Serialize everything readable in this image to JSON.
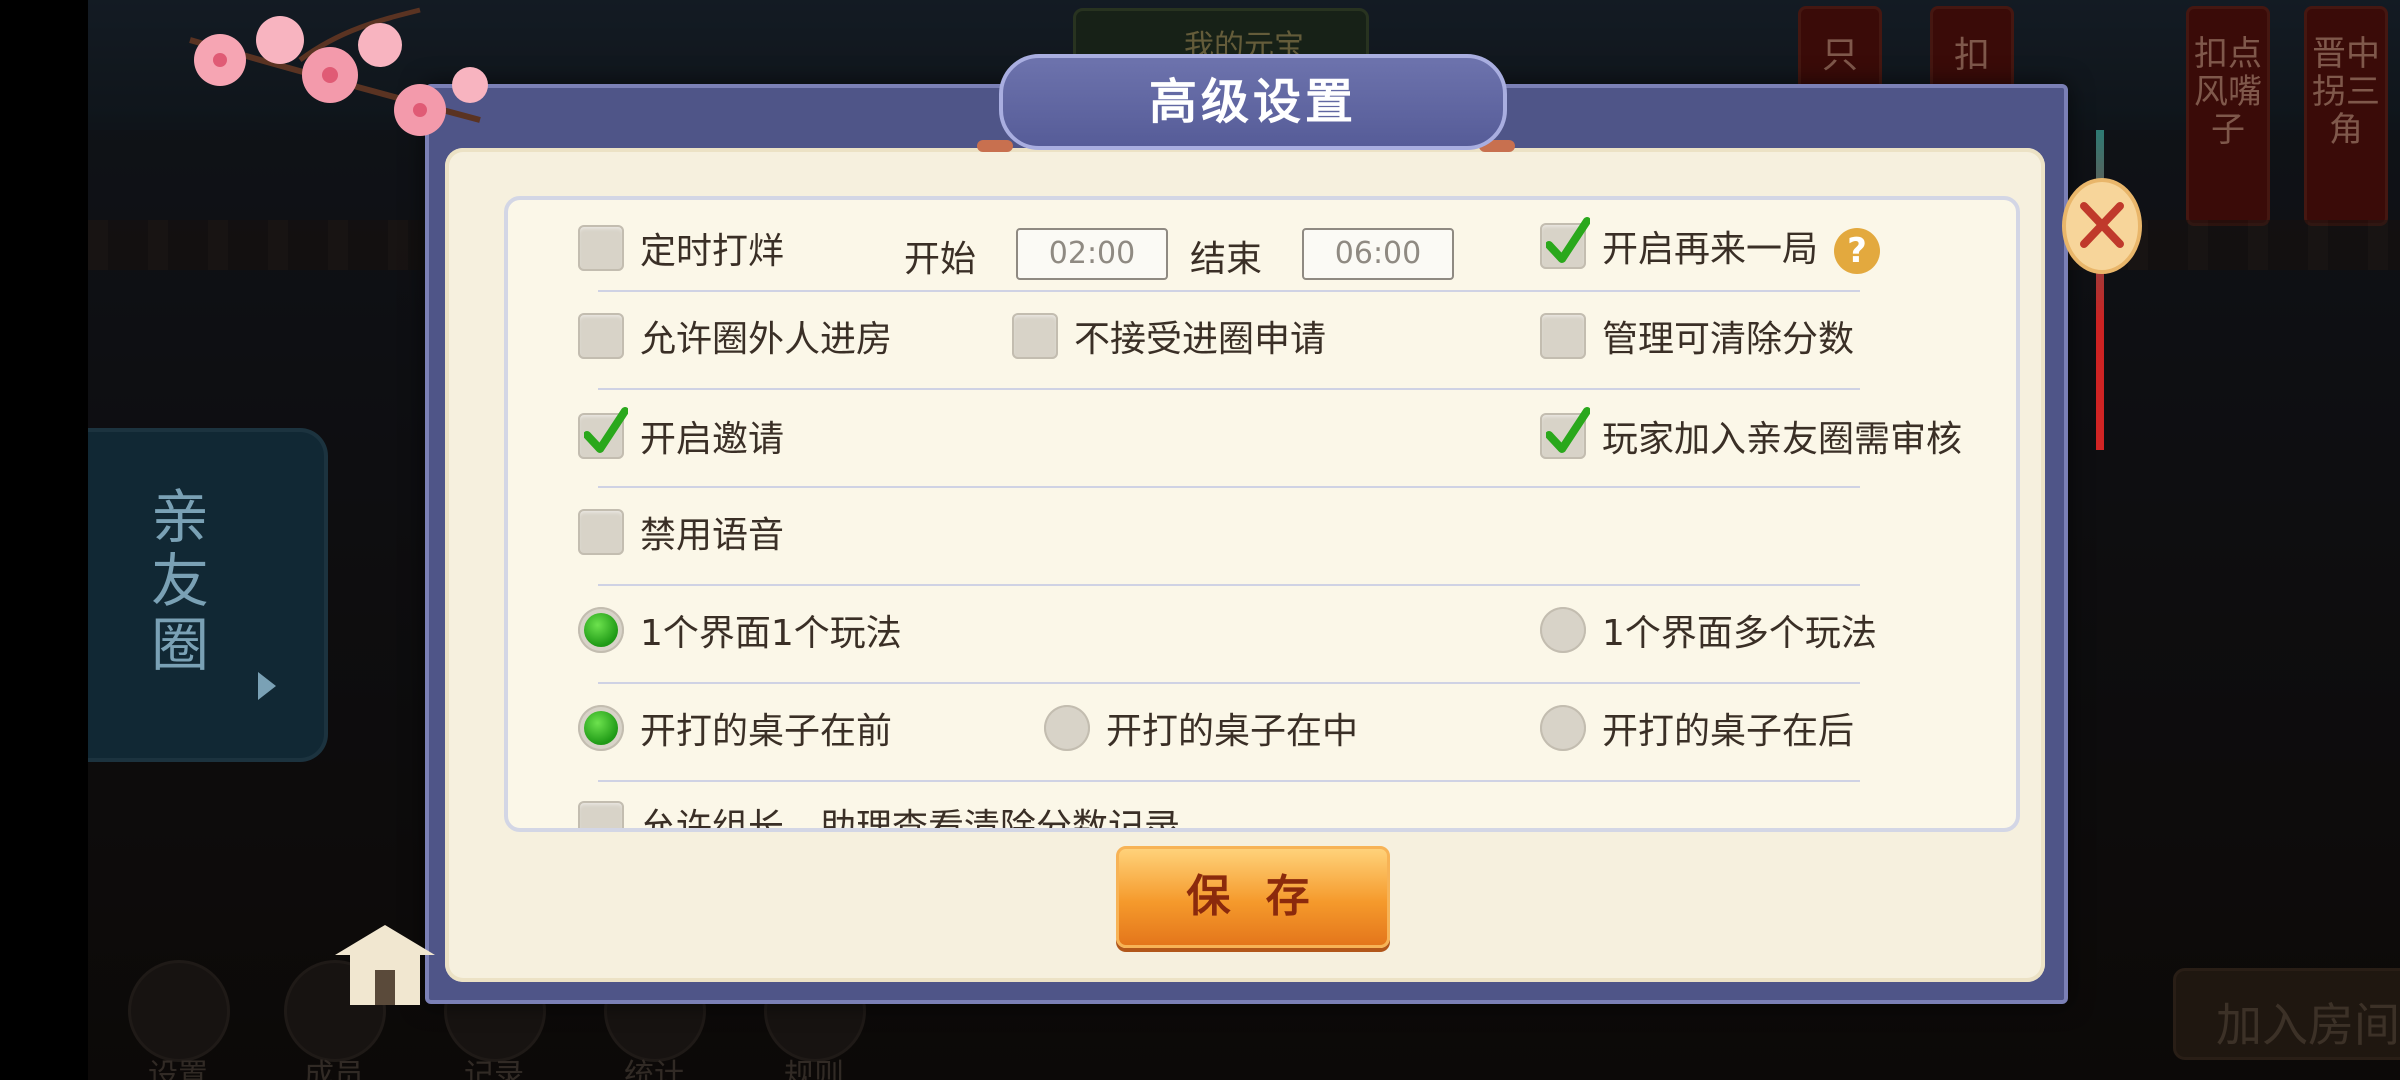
{
  "background": {
    "coin_label": "我的元宝",
    "banners": [
      "只",
      "扣",
      "扣点风嘴子",
      "晋中拐三角"
    ],
    "friend_circle_label": "亲友圈",
    "nav": [
      "设置",
      "成员",
      "记录",
      "统计",
      "规则"
    ],
    "join_room_label": "加入房间"
  },
  "dialog": {
    "title": "高级设置",
    "timed": {
      "label": "定时打烊",
      "checked": false,
      "start_label": "开始",
      "start_value": "02:00",
      "end_label": "结束",
      "end_value": "06:00"
    },
    "replay": {
      "label": "开启再来一局",
      "checked": true
    },
    "help_label": "?",
    "outsiders": {
      "label": "允许圈外人进房",
      "checked": false
    },
    "reject_apply": {
      "label": "不接受进圈申请",
      "checked": false
    },
    "admin_clear": {
      "label": "管理可清除分数",
      "checked": false
    },
    "invite": {
      "label": "开启邀请",
      "checked": true
    },
    "review_join": {
      "label": "玩家加入亲友圈需审核",
      "checked": true
    },
    "mute_voice": {
      "label": "禁用语音",
      "checked": false
    },
    "one_mode": {
      "label": "1个界面1个玩法",
      "selected": true
    },
    "multi_mode": {
      "label": "1个界面多个玩法",
      "selected": false
    },
    "table_front": {
      "label": "开打的桌子在前",
      "selected": true
    },
    "table_middle": {
      "label": "开打的桌子在中",
      "selected": false
    },
    "table_back": {
      "label": "开打的桌子在后",
      "selected": false
    },
    "leader_view": {
      "label": "允许组长、助理查看清除分数记录",
      "checked": false
    },
    "save_label": "保 存"
  },
  "colors": {
    "accent_green": "#2aa81c",
    "frame": "#4f5588",
    "panel": "#f6f0de",
    "save_orange": "#f59a2c"
  }
}
